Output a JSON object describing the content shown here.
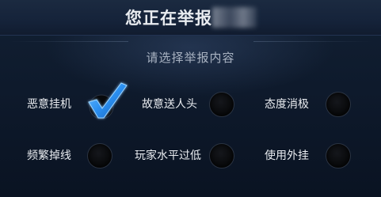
{
  "header": {
    "title": "您正在举报"
  },
  "subtitle": "请选择举报内容",
  "options": [
    {
      "label": "恶意挂机",
      "selected": true
    },
    {
      "label": "故意送人头",
      "selected": false
    },
    {
      "label": "态度消极",
      "selected": false
    },
    {
      "label": "频繁掉线",
      "selected": false
    },
    {
      "label": "玩家水平过低",
      "selected": false
    },
    {
      "label": "使用外挂",
      "selected": false
    }
  ],
  "colors": {
    "check_blue": "#2b8ff0",
    "text": "#e8ebef",
    "background": "#0e1a2c"
  },
  "icons": {
    "selected": "checkmark-icon",
    "unselected": "radio-circle-icon"
  }
}
